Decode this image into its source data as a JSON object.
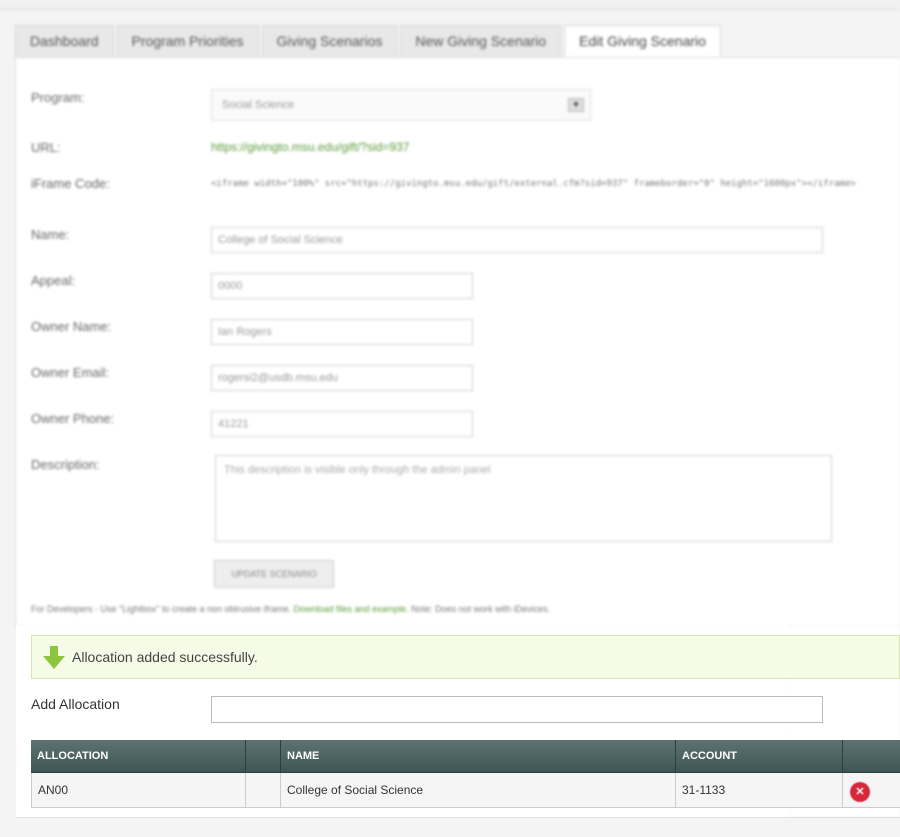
{
  "tabs": [
    {
      "label": "Dashboard"
    },
    {
      "label": "Program Priorities"
    },
    {
      "label": "Giving Scenarios"
    },
    {
      "label": "New Giving Scenario"
    },
    {
      "label": "Edit Giving Scenario",
      "active": true
    }
  ],
  "form": {
    "program_label": "Program:",
    "program_value": "Social Science",
    "url_label": "URL:",
    "url_value": "https://givingto.msu.edu/gift/?sid=937",
    "iframe_label": "iFrame Code:",
    "iframe_value": "<iframe width=\"100%\" src=\"https://givingto.msu.edu/gift/external.cfm?sid=937\" frameborder=\"0\" height=\"1600px\"></iframe>",
    "name_label": "Name:",
    "name_value": "College of Social Science",
    "appeal_label": "Appeal:",
    "appeal_value": "0000",
    "owner_name_label": "Owner Name:",
    "owner_name_value": "Ian Rogers",
    "owner_email_label": "Owner Email:",
    "owner_email_value": "rogersi2@usdb.msu.edu",
    "owner_phone_label": "Owner Phone:",
    "owner_phone_value": "41221",
    "description_label": "Description:",
    "description_value": "This description is visible only through the admin panel",
    "update_button": "UPDATE SCENARIO"
  },
  "dev_note": {
    "prefix": "For Developers - Use \"Lightbox\" to create a non obtrusive iframe.",
    "link": "Download files and example.",
    "suffix": "Note: Does not work with iDevices."
  },
  "alert": {
    "message": "Allocation added successfully.",
    "color": "#f6fbe7"
  },
  "add_allocation": {
    "label": "Add Allocation",
    "value": ""
  },
  "table": {
    "headers": [
      "ALLOCATION",
      "",
      "NAME",
      "ACCOUNT",
      ""
    ],
    "rows": [
      {
        "allocation": "AN00",
        "extra": "",
        "name": "College of Social Science",
        "account": "31-1133"
      }
    ]
  },
  "colors": {
    "header_bg": "#4e6564",
    "link_green": "#5a9a3a",
    "delete_red": "#d6283a"
  }
}
